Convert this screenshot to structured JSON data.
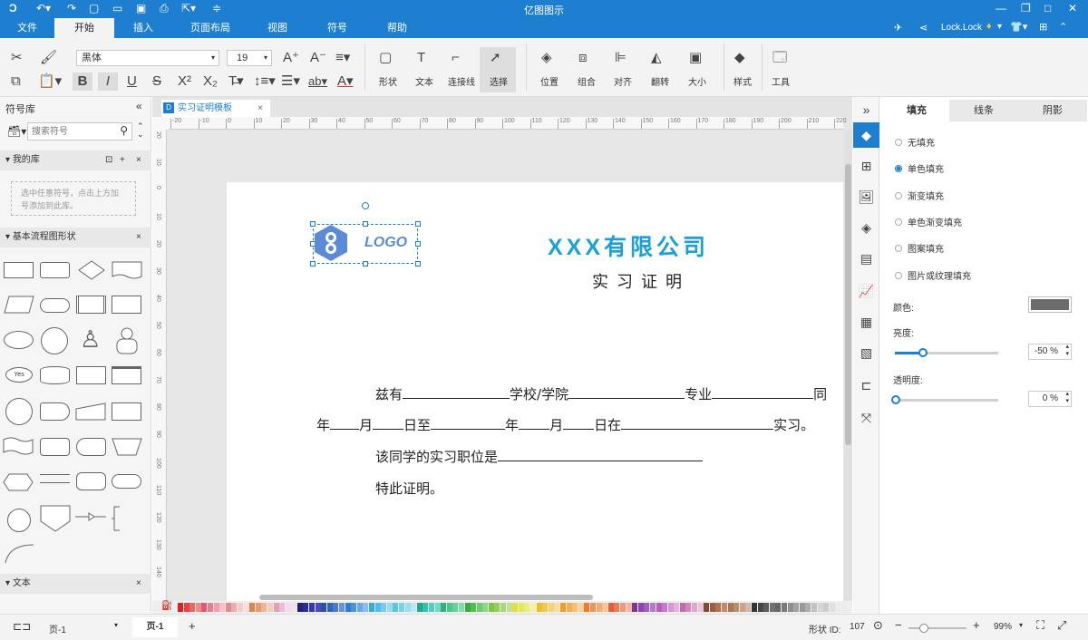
{
  "app": {
    "title": "亿图图示"
  },
  "menu": {
    "items": [
      "文件",
      "开始",
      "插入",
      "页面布局",
      "视图",
      "符号",
      "帮助"
    ],
    "active_index": 1
  },
  "user": {
    "name": "Lock.Lock"
  },
  "ribbon": {
    "font_family": "黑体",
    "font_size": "19",
    "labels": {
      "shape": "形状",
      "text": "文本",
      "connector": "连接线",
      "select": "选择",
      "position": "位置",
      "group": "组合",
      "align": "对齐",
      "rotate": "翻转",
      "size": "大小",
      "style": "样式",
      "tools": "工具"
    }
  },
  "library": {
    "title": "符号库",
    "search_placeholder": "搜索符号",
    "my_library": "我的库",
    "my_library_hint": "选中任意符号，点击上方加号添加到此库。",
    "basic_flow": "基本流程图形状",
    "text_section": "文本"
  },
  "document_tab": {
    "name": "实习证明模板"
  },
  "ruler": {
    "top_ticks": [
      "-20",
      "-10",
      "0",
      "10",
      "20",
      "30",
      "40",
      "50",
      "60",
      "70",
      "80",
      "90",
      "100",
      "110",
      "120",
      "130",
      "140",
      "150",
      "160",
      "170",
      "180",
      "190",
      "200",
      "210",
      "220"
    ],
    "left_ticks": [
      "20",
      "10",
      "0",
      "10",
      "20",
      "30",
      "40",
      "50",
      "60",
      "70",
      "80",
      "90",
      "100",
      "110",
      "120",
      "130",
      "140"
    ]
  },
  "canvas": {
    "logo_text": "LOGO",
    "company": "XXX有限公司",
    "subtitle": "实 习 证 明",
    "line1": {
      "a": "兹有",
      "b": "学校/学院",
      "c": "专业",
      "d": "同"
    },
    "line2": {
      "a": "年",
      "b": "月",
      "c": "日至",
      "d": "年",
      "e": "月",
      "f": "日在",
      "g": "实习。"
    },
    "line3": "该同学的实习职位是",
    "line4": "特此证明。"
  },
  "right_panel": {
    "tabs": [
      "填充",
      "线条",
      "阴影"
    ],
    "options": [
      "无填充",
      "单色填充",
      "渐变填充",
      "单色渐变填充",
      "图案填充",
      "图片或纹理填充"
    ],
    "selected_option": "单色填充",
    "color_label": "颜色:",
    "color_value": "#6b6b6b",
    "brightness_label": "亮度:",
    "brightness_value": "-50 %",
    "transparency_label": "透明度:",
    "transparency_value": "0 %"
  },
  "status": {
    "page_name": "页-1",
    "page_tab": "页-1",
    "shape_id_label": "形状 ID:",
    "shape_id": "107",
    "zoom": "99%"
  },
  "colors": {
    "accent": "#1e7fd1",
    "company_text": "#1ba0d8",
    "logo": "#5b8bd6"
  }
}
